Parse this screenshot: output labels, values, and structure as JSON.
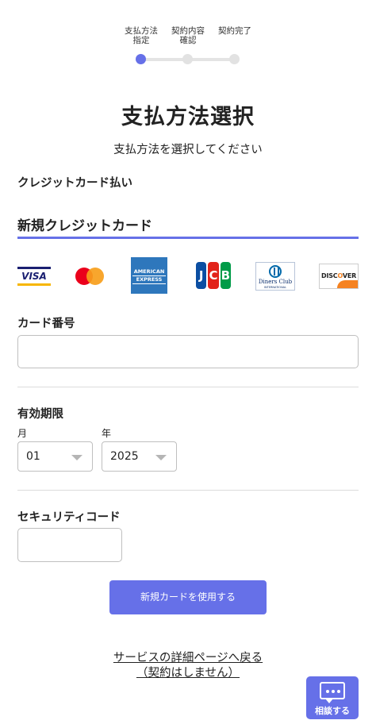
{
  "stepper": {
    "steps": [
      {
        "label_line1": "支払方法",
        "label_line2": "指定",
        "state": "active"
      },
      {
        "label_line1": "契約内容",
        "label_line2": "確認",
        "state": "pending"
      },
      {
        "label_line1": "契約完了",
        "label_line2": "",
        "state": "pending"
      }
    ]
  },
  "page": {
    "title": "支払方法選択",
    "subtitle": "支払方法を選択してください"
  },
  "payment": {
    "section_label": "クレジットカード払い",
    "tab_label": "新規クレジットカード",
    "brands": [
      {
        "name": "VISA",
        "icon": "visa-logo"
      },
      {
        "name": "Mastercard",
        "icon": "mastercard-logo"
      },
      {
        "name": "AMERICAN EXPRESS",
        "line1": "AMERICAN",
        "line2": "EXPRESS",
        "icon": "amex-logo"
      },
      {
        "name": "JCB",
        "letters": [
          "J",
          "C",
          "B"
        ],
        "icon": "jcb-logo"
      },
      {
        "name": "Diners Club",
        "sub": "INTERNATIONAL",
        "icon": "diners-logo"
      },
      {
        "name": "DISCOVER",
        "pre": "DISC",
        "o": "O",
        "post": "VER",
        "icon": "discover-logo"
      }
    ],
    "brand_colors": {
      "accent": "#6670e8",
      "visa": "#1a1f71",
      "mc_red": "#eb001b",
      "mc_yellow": "#f79e1b",
      "amex": "#2e77bc"
    }
  },
  "form": {
    "card_number_label": "カード番号",
    "card_number_value": "",
    "expiry_label": "有効期限",
    "month_label": "月",
    "month_value": "01",
    "year_label": "年",
    "year_value": "2025",
    "security_label": "セキュリティコード",
    "security_value": "",
    "submit_label": "新規カードを使用する"
  },
  "footer": {
    "back_line1": "サービスの詳細ページへ戻る",
    "back_line2": "（契約はしません）"
  },
  "chat": {
    "label": "相談する",
    "icon": "chat-bubble-icon"
  }
}
